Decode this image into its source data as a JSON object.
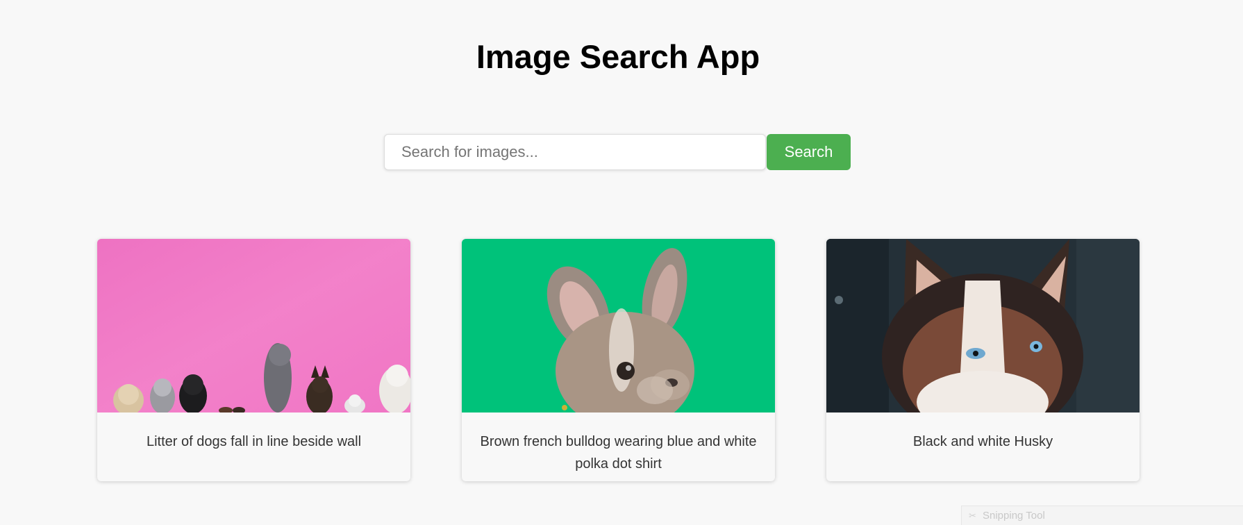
{
  "header": {
    "title": "Image Search App"
  },
  "search": {
    "placeholder": "Search for images...",
    "value": "",
    "button_label": "Search"
  },
  "results": [
    {
      "caption": "Litter of dogs fall in line beside wall"
    },
    {
      "caption": "Brown french bulldog wearing blue and white polka dot shirt"
    },
    {
      "caption": "Black and white Husky"
    }
  ],
  "overlay": {
    "snipping_tool_label": "Snipping Tool"
  },
  "colors": {
    "accent": "#4caf50",
    "background": "#f8f8f8"
  }
}
